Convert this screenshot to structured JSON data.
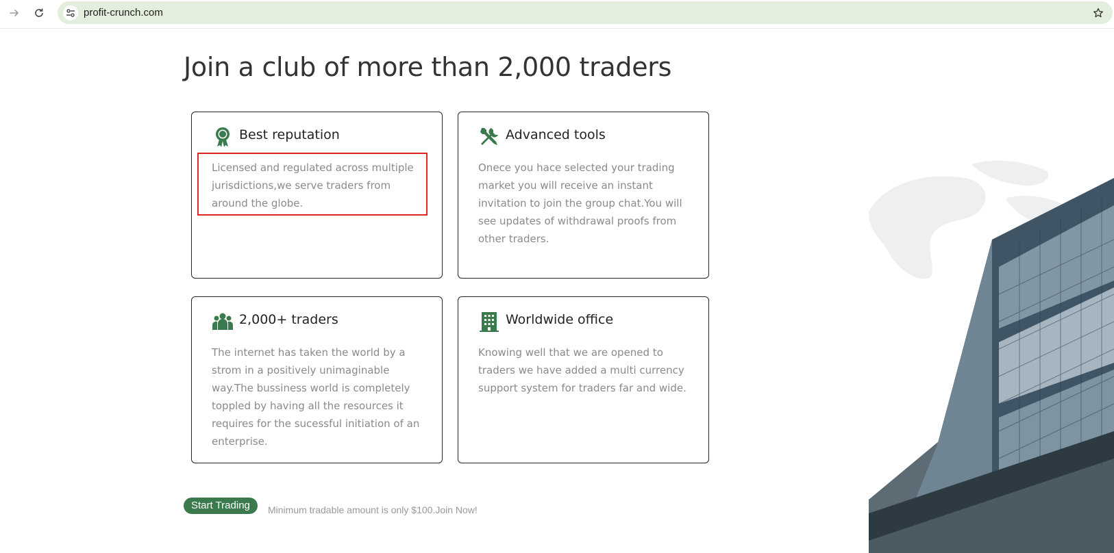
{
  "browser": {
    "url": "profit-crunch.com"
  },
  "page": {
    "heading": "Join a club of more than 2,000 traders",
    "cards": [
      {
        "icon": "award-icon",
        "title": "Best reputation",
        "description": "Licensed and regulated across multiple jurisdictions,we serve traders from around the globe."
      },
      {
        "icon": "tools-icon",
        "title": "Advanced tools",
        "description": "Onece you hace selected your trading market you will receive an instant invitation to join the group chat.You will see updates of withdrawal proofs from other traders."
      },
      {
        "icon": "users-icon",
        "title": "2,000+ traders",
        "description": "The internet has taken the world by a strom in a positively unimaginable way.The bussiness world is completely toppled by having all the resources it requires for the sucessful initiation of an enterprise."
      },
      {
        "icon": "building-icon",
        "title": "Worldwide office",
        "description": "Knowing well that we are opened to traders we have added a multi currency support system for traders far and wide."
      }
    ],
    "cta": {
      "button_label": "Start Trading",
      "note": "Minimum tradable amount is only $100.Join Now!"
    }
  },
  "colors": {
    "accent": "#3b7a4c",
    "highlight": "#e02424",
    "url_bar": "#e3eedc"
  }
}
